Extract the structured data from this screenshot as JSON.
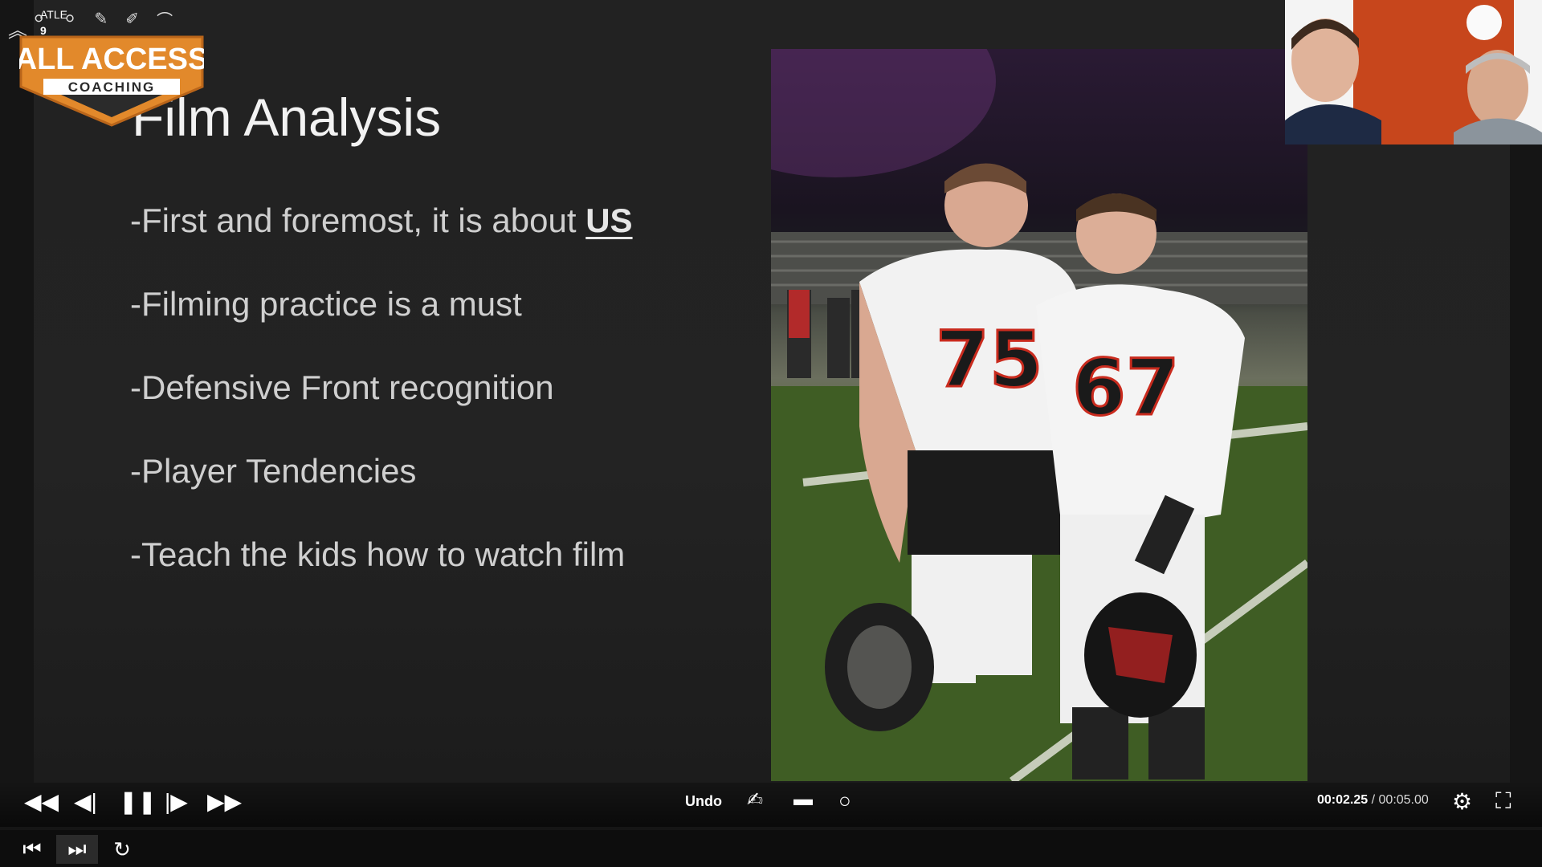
{
  "slide": {
    "title": "Film Analysis",
    "bullets": [
      {
        "prefix": "-First and foremost, it is about ",
        "emphasis": "US"
      },
      {
        "prefix": "-Filming practice is a must",
        "emphasis": ""
      },
      {
        "prefix": "-Defensive Front recognition",
        "emphasis": ""
      },
      {
        "prefix": "-Player Tendencies",
        "emphasis": ""
      },
      {
        "prefix": "-Teach the kids how to watch film",
        "emphasis": ""
      }
    ],
    "jersey_numbers": [
      "75",
      "67"
    ]
  },
  "logo": {
    "line1": "ALL ACCESS",
    "line2": "COACHING",
    "primary_color": "#e2892b",
    "text_color": "#ffffff"
  },
  "toolbar": {
    "top_label": "ATLE",
    "badge": "9",
    "icons": [
      "collapse-chevron-icon",
      "circle-icon",
      "circle-icon",
      "pencil-icon",
      "brush-icon",
      "helmet-icon"
    ]
  },
  "player": {
    "undo_label": "Undo",
    "current_time": "00:02.25",
    "separator": " / ",
    "duration": "00:05.00",
    "icons": [
      "rewind-icon",
      "step-back-icon",
      "pause-icon",
      "step-forward-icon",
      "fast-forward-icon",
      "pen-draw-icon",
      "comment-icon",
      "circle-shape-icon",
      "settings-gear-icon",
      "fullscreen-icon"
    ],
    "timeline_icons": [
      "skip-start-icon",
      "skip-end-icon",
      "refresh-icon"
    ],
    "accent_green": "#3f9e2f",
    "playhead_color": "#f2f2f2",
    "end_marker_color": "#e0301e"
  }
}
